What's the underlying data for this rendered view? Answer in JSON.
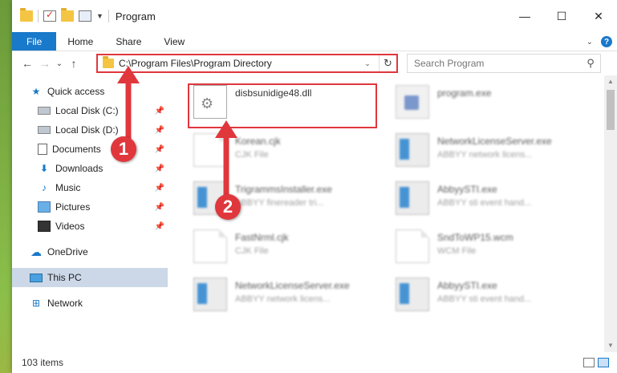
{
  "window": {
    "title": "Program",
    "controls": {
      "minimize": "—",
      "maximize": "☐",
      "close": "✕"
    }
  },
  "ribbon": {
    "tabs": [
      "File",
      "Home",
      "Share",
      "View"
    ],
    "help": "?"
  },
  "nav": {
    "back": "←",
    "forward": "→",
    "recent": "⌄",
    "up": "↑"
  },
  "address": {
    "path": "C:\\Program Files\\Program Directory",
    "dropdown": "⌄",
    "refresh": "↻"
  },
  "search": {
    "placeholder": "Search Program",
    "icon": "⚲"
  },
  "sidebar": {
    "items": [
      {
        "label": "Quick access",
        "icon": "star-icon",
        "glyph": "★",
        "pinned": false
      },
      {
        "label": "Local Disk (C:)",
        "icon": "drive-icon",
        "glyph": "",
        "pinned": true
      },
      {
        "label": "Local Disk (D:)",
        "icon": "drive-icon",
        "glyph": "",
        "pinned": true
      },
      {
        "label": "Documents",
        "icon": "documents-icon",
        "glyph": "",
        "pinned": true
      },
      {
        "label": "Downloads",
        "icon": "downloads-icon",
        "glyph": "⬇",
        "pinned": true
      },
      {
        "label": "Music",
        "icon": "music-icon",
        "glyph": "♪",
        "pinned": true
      },
      {
        "label": "Pictures",
        "icon": "pictures-icon",
        "glyph": "",
        "pinned": true
      },
      {
        "label": "Videos",
        "icon": "videos-icon",
        "glyph": "",
        "pinned": true
      },
      {
        "label": "OneDrive",
        "icon": "onedrive-icon",
        "glyph": "☁"
      },
      {
        "label": "This PC",
        "icon": "this-pc-icon",
        "glyph": "",
        "selected": true
      },
      {
        "label": "Network",
        "icon": "network-icon",
        "glyph": "🖧"
      }
    ],
    "pin_glyph": "📌"
  },
  "files": [
    {
      "name": "disbsunidige48.dll",
      "type": "",
      "icon": "dll-file-icon",
      "highlighted": true
    },
    {
      "name": "program.exe",
      "type": "",
      "icon": "program-exe-icon"
    },
    {
      "name": "Korean.cjk",
      "type": "CJK File",
      "icon": "file-icon"
    },
    {
      "name": "NetworkLicenseServer.exe",
      "type": "ABBYY network licens...",
      "icon": "exe-icon"
    },
    {
      "name": "TrigrammsInstaller.exe",
      "type": "ABBYY finereader tri...",
      "icon": "exe-icon"
    },
    {
      "name": "AbbyySTI.exe",
      "type": "ABBYY sti event hand...",
      "icon": "exe-icon"
    },
    {
      "name": "FastNrml.cjk",
      "type": "CJK File",
      "icon": "file-icon"
    },
    {
      "name": "SndToWP15.wcm",
      "type": "WCM File",
      "icon": "file-icon"
    },
    {
      "name": "NetworkLicenseServer.exe",
      "type": "ABBYY network licens...",
      "icon": "exe-icon"
    },
    {
      "name": "AbbyySTI.exe",
      "type": "ABBYY sti event hand...",
      "icon": "exe-icon"
    }
  ],
  "status": {
    "item_count": "103 items"
  },
  "annotations": {
    "step1": "1",
    "step2": "2",
    "color": "#e0373d"
  }
}
